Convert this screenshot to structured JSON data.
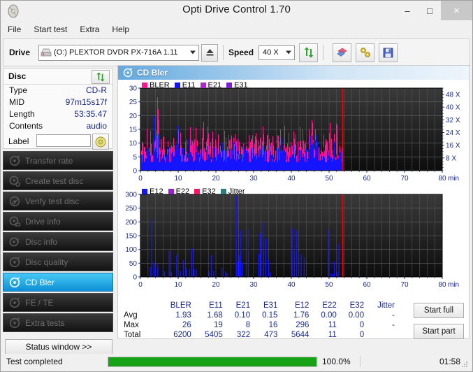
{
  "window": {
    "title": "Opti Drive Control 1.70",
    "icon": "disc-icon",
    "minimize": "–",
    "maximize": "□",
    "close": "×"
  },
  "menu": [
    "File",
    "Start test",
    "Extra",
    "Help"
  ],
  "toolbar": {
    "drive_label": "Drive",
    "drive_value": "(O:)  PLEXTOR DVDR  PX-716A 1.11",
    "eject_icon": "eject-icon",
    "speed_label": "Speed",
    "speed_value": "40 X",
    "refresh_icon": "refresh-icon",
    "eraser_icon": "eraser-icon",
    "tools_icon": "tools-icon",
    "save_icon": "save-icon"
  },
  "disc": {
    "header": "Disc",
    "refresh_icon": "refresh-icon",
    "rows": [
      {
        "key": "Type",
        "value": "CD-R"
      },
      {
        "key": "MID",
        "value": "97m15s17f"
      },
      {
        "key": "Length",
        "value": "53:35.47"
      },
      {
        "key": "Contents",
        "value": "audio"
      }
    ],
    "label_key": "Label",
    "label_value": "",
    "label_placeholder": "",
    "cd_icon": "cd-icon"
  },
  "sidebar": {
    "items": [
      {
        "label": "Transfer rate",
        "icon": "disc-test-icon",
        "active": false
      },
      {
        "label": "Create test disc",
        "icon": "disc-create-icon",
        "active": false
      },
      {
        "label": "Verify test disc",
        "icon": "disc-verify-icon",
        "active": false
      },
      {
        "label": "Drive info",
        "icon": "disc-drive-icon",
        "active": false
      },
      {
        "label": "Disc info",
        "icon": "disc-info-icon",
        "active": false
      },
      {
        "label": "Disc quality",
        "icon": "disc-quality-icon",
        "active": false
      },
      {
        "label": "CD Bler",
        "icon": "disc-bler-icon",
        "active": true
      },
      {
        "label": "FE / TE",
        "icon": "disc-fete-icon",
        "active": false
      },
      {
        "label": "Extra tests",
        "icon": "disc-extra-icon",
        "active": false
      }
    ],
    "status_window": "Status window >>"
  },
  "main": {
    "header": "CD Bler",
    "header_icon": "disc-bler-icon"
  },
  "actions": {
    "start_full": "Start full",
    "start_part": "Start part"
  },
  "statusbar": {
    "text": "Test completed",
    "progress_pct": "100.0%",
    "progress_value": 100,
    "elapsed": "01:58",
    "grip_icon": "resize-grip-icon"
  },
  "stats": {
    "columns": [
      "BLER",
      "E11",
      "E21",
      "E31",
      "E12",
      "E22",
      "E32",
      "Jitter"
    ],
    "rows": [
      {
        "label": "Avg",
        "values": [
          "1.93",
          "1.68",
          "0.10",
          "0.15",
          "1.76",
          "0.00",
          "0.00",
          "-"
        ]
      },
      {
        "label": "Max",
        "values": [
          "26",
          "19",
          "8",
          "16",
          "296",
          "11",
          "0",
          "-"
        ]
      },
      {
        "label": "Total",
        "values": [
          "6200",
          "5405",
          "322",
          "473",
          "5644",
          "11",
          "0",
          ""
        ]
      }
    ]
  },
  "chart_data": [
    {
      "id": "bler-chart",
      "type": "line",
      "title": "",
      "xlabel": "min",
      "ylabel": "",
      "xlim": [
        0,
        80
      ],
      "ylim": [
        0,
        30
      ],
      "yticks": [
        0,
        5,
        10,
        15,
        20,
        25,
        30
      ],
      "xticks": [
        0,
        10,
        20,
        30,
        40,
        50,
        60,
        70,
        80
      ],
      "y2lim": [
        0,
        52
      ],
      "y2ticks": [
        "8 X",
        "16 X",
        "24 X",
        "32 X",
        "40 X",
        "48 X"
      ],
      "grid": true,
      "plot_bg": "#1b1b1b",
      "legend_position": "top-left",
      "data_end_min": 53.6,
      "marker_min": 53.6,
      "marker_color": "#ff0000",
      "legend": [
        {
          "name": "BLER",
          "color": "#ff1493"
        },
        {
          "name": "E11",
          "color": "#1414ff"
        },
        {
          "name": "E21",
          "color": "#b026d3"
        },
        {
          "name": "E31",
          "color": "#7b1fd4"
        }
      ],
      "series": [
        {
          "name": "BLER",
          "color": "#ff1493",
          "values": [
            6,
            9,
            8,
            7,
            23,
            10,
            12,
            9,
            20,
            14,
            26,
            11,
            9,
            13,
            8,
            7,
            12,
            10,
            9,
            14,
            8,
            12,
            16,
            9,
            13,
            11,
            7,
            10,
            12,
            15,
            9,
            8,
            14,
            11,
            10,
            9,
            12,
            16,
            8,
            11,
            13,
            9,
            10,
            12,
            8,
            14,
            10,
            9,
            12,
            11,
            13,
            8,
            10,
            15,
            9,
            12,
            11,
            10,
            13,
            9,
            8,
            12,
            10,
            14,
            11,
            9,
            13,
            10,
            12,
            8,
            11,
            9,
            14,
            10,
            12,
            11,
            9,
            13,
            10,
            8,
            12,
            11,
            9,
            14,
            10,
            13,
            9,
            11,
            12,
            8,
            10,
            14,
            11,
            9,
            13,
            10,
            12,
            8,
            11,
            9,
            18,
            16,
            14,
            12,
            16,
            11,
            9,
            13,
            10,
            12,
            8,
            11,
            14,
            9,
            13,
            10,
            16,
            12,
            11,
            9
          ]
        },
        {
          "name": "E11",
          "color": "#1414ff",
          "values": [
            5,
            8,
            6,
            5,
            17,
            7,
            9,
            6,
            19,
            11,
            14,
            8,
            6,
            10,
            6,
            5,
            9,
            7,
            6,
            11,
            6,
            9,
            16,
            7,
            10,
            8,
            5,
            7,
            9,
            12,
            6,
            5,
            11,
            8,
            7,
            6,
            9,
            13,
            6,
            8,
            10,
            6,
            7,
            9,
            6,
            11,
            7,
            6,
            9,
            8,
            10,
            6,
            7,
            12,
            6,
            9,
            8,
            7,
            10,
            6,
            5,
            9,
            7,
            11,
            8,
            6,
            10,
            7,
            9,
            6,
            8,
            6,
            11,
            7,
            9,
            8,
            6,
            10,
            7,
            5,
            9,
            8,
            6,
            11,
            7,
            10,
            6,
            8,
            9,
            5,
            7,
            11,
            8,
            6,
            10,
            7,
            9,
            5,
            8,
            6,
            13,
            12,
            10,
            9,
            12,
            8,
            6,
            10,
            7,
            9,
            5,
            8,
            11,
            6,
            10,
            7,
            13,
            9,
            8,
            6
          ]
        },
        {
          "name": "E21",
          "color": "#b026d3",
          "values": [
            0,
            0,
            0,
            0,
            2,
            0,
            0,
            0,
            3,
            0,
            4,
            0,
            0,
            0,
            0,
            0,
            0,
            0,
            0,
            2,
            0,
            0,
            5,
            0,
            0,
            0,
            0,
            0,
            0,
            3,
            0,
            0,
            0,
            0,
            0,
            0,
            0,
            4,
            0,
            0,
            0,
            0,
            0,
            0,
            0,
            0,
            0,
            0,
            0,
            0,
            2,
            0,
            0,
            6,
            0,
            0,
            0,
            0,
            0,
            0,
            0,
            0,
            0,
            3,
            0,
            0,
            0,
            0,
            0,
            0,
            0,
            0,
            5,
            0,
            0,
            0,
            0,
            0,
            0,
            0,
            0,
            0,
            0,
            4,
            0,
            0,
            0,
            0,
            0,
            0,
            0,
            8,
            0,
            0,
            0,
            0,
            0,
            0,
            0,
            0,
            6,
            4,
            0,
            0,
            5,
            0,
            0,
            0,
            0,
            0,
            0,
            0,
            4,
            0,
            0,
            0,
            7,
            0,
            0,
            0
          ]
        },
        {
          "name": "E31",
          "color": "#7b1fd4",
          "values": [
            0,
            0,
            0,
            0,
            0,
            0,
            0,
            0,
            0,
            0,
            0,
            0,
            0,
            0,
            0,
            0,
            0,
            0,
            0,
            0,
            0,
            0,
            0,
            0,
            0,
            0,
            0,
            0,
            0,
            0,
            0,
            0,
            0,
            0,
            0,
            0,
            0,
            0,
            0,
            0,
            0,
            0,
            0,
            0,
            0,
            0,
            0,
            0,
            0,
            0,
            0,
            0,
            0,
            0,
            0,
            0,
            0,
            0,
            0,
            0,
            0,
            0,
            0,
            0,
            0,
            0,
            0,
            0,
            0,
            0,
            0,
            0,
            0,
            0,
            0,
            0,
            0,
            0,
            0,
            0,
            0,
            0,
            0,
            0,
            0,
            0,
            0,
            0,
            0,
            0,
            0,
            0,
            0,
            0,
            0,
            0,
            0,
            0,
            0,
            0,
            16,
            0,
            0,
            0,
            0,
            0,
            0,
            0,
            0,
            0,
            0,
            0,
            0,
            0,
            0,
            0,
            0,
            0,
            0,
            0
          ]
        }
      ]
    },
    {
      "id": "e12-chart",
      "type": "line",
      "title": "",
      "xlabel": "min",
      "ylabel": "",
      "xlim": [
        0,
        80
      ],
      "ylim": [
        0,
        300
      ],
      "yticks": [
        0,
        50,
        100,
        150,
        200,
        250,
        300
      ],
      "xticks": [
        0,
        10,
        20,
        30,
        40,
        50,
        60,
        70,
        80
      ],
      "grid": true,
      "plot_bg": "#1b1b1b",
      "legend_position": "top-left",
      "data_end_min": 53.6,
      "marker_min": 53.6,
      "marker_color": "#ff0000",
      "legend": [
        {
          "name": "E12",
          "color": "#1414ff"
        },
        {
          "name": "E22",
          "color": "#9a1fd4"
        },
        {
          "name": "E32",
          "color": "#ff1464"
        },
        {
          "name": "Jitter",
          "color": "#2e7d7d"
        }
      ],
      "series": [
        {
          "name": "E12",
          "color": "#1414ff",
          "values": [
            {
              "x": 2.6,
              "y": 35
            },
            {
              "x": 3.0,
              "y": 209
            },
            {
              "x": 3.6,
              "y": 52
            },
            {
              "x": 4.0,
              "y": 30
            },
            {
              "x": 4.6,
              "y": 45
            },
            {
              "x": 6.0,
              "y": 31
            },
            {
              "x": 6.4,
              "y": 20
            },
            {
              "x": 7.6,
              "y": 95
            },
            {
              "x": 8.2,
              "y": 18
            },
            {
              "x": 9.6,
              "y": 80
            },
            {
              "x": 10.6,
              "y": 22
            },
            {
              "x": 11.4,
              "y": 61
            },
            {
              "x": 12.2,
              "y": 30
            },
            {
              "x": 13.0,
              "y": 28
            },
            {
              "x": 13.6,
              "y": 104
            },
            {
              "x": 14.2,
              "y": 30
            },
            {
              "x": 14.8,
              "y": 27
            },
            {
              "x": 18.2,
              "y": 20
            },
            {
              "x": 18.8,
              "y": 79
            },
            {
              "x": 19.4,
              "y": 22
            },
            {
              "x": 21.6,
              "y": 34
            },
            {
              "x": 22.6,
              "y": 20
            },
            {
              "x": 23.0,
              "y": 14
            },
            {
              "x": 25.4,
              "y": 295
            },
            {
              "x": 25.8,
              "y": 55
            },
            {
              "x": 26.2,
              "y": 78
            },
            {
              "x": 26.6,
              "y": 169
            },
            {
              "x": 27.0,
              "y": 52
            },
            {
              "x": 28.6,
              "y": 175
            },
            {
              "x": 31.4,
              "y": 84
            },
            {
              "x": 31.8,
              "y": 159
            },
            {
              "x": 32.6,
              "y": 198
            },
            {
              "x": 33.2,
              "y": 140
            },
            {
              "x": 34.0,
              "y": 61
            },
            {
              "x": 34.4,
              "y": 16
            },
            {
              "x": 40.2,
              "y": 178
            },
            {
              "x": 40.8,
              "y": 93
            },
            {
              "x": 41.4,
              "y": 170
            },
            {
              "x": 42.6,
              "y": 84
            },
            {
              "x": 43.4,
              "y": 72
            },
            {
              "x": 49.8,
              "y": 172
            },
            {
              "x": 50.6,
              "y": 12
            },
            {
              "x": 51.0,
              "y": 10
            },
            {
              "x": 51.4,
              "y": 55
            },
            {
              "x": 52.2,
              "y": 18
            },
            {
              "x": 52.6,
              "y": 120
            }
          ]
        },
        {
          "name": "E22",
          "color": "#9a1fd4",
          "values": []
        },
        {
          "name": "E32",
          "color": "#ff1464",
          "values": []
        },
        {
          "name": "Jitter",
          "color": "#2e7d7d",
          "values": []
        }
      ]
    }
  ]
}
